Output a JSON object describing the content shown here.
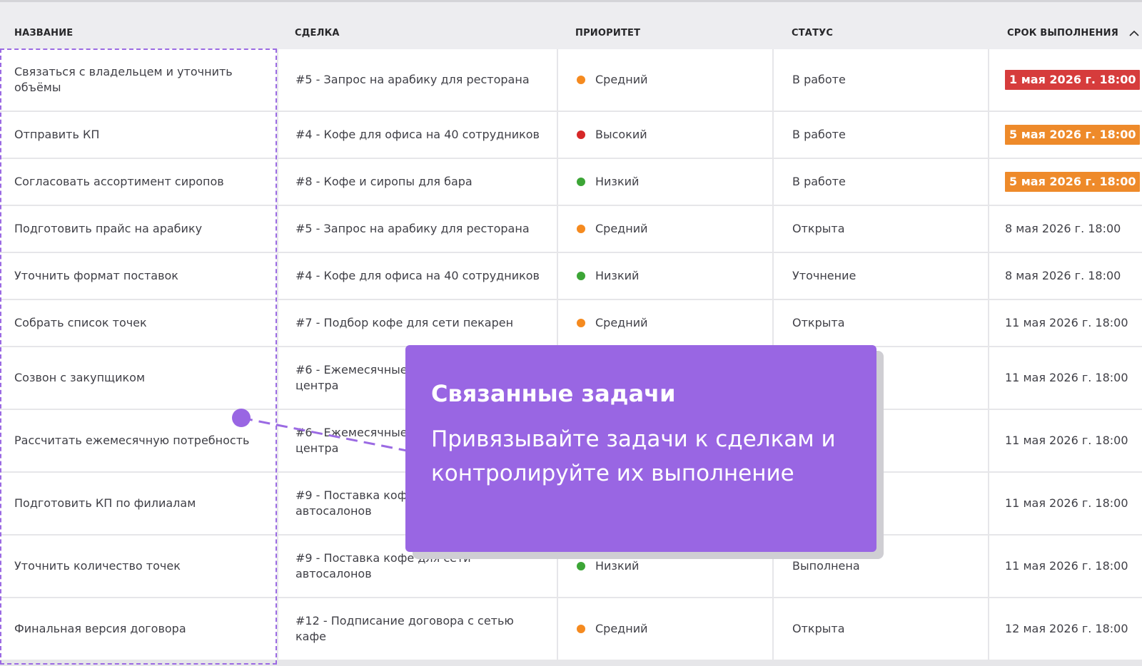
{
  "columns": {
    "name": "НАЗВАНИЕ",
    "deal": "СДЕЛКА",
    "priority": "ПРИОРИТЕТ",
    "status": "СТАТУС",
    "due": "СРОК ВЫПОЛНЕНИЯ"
  },
  "sort": {
    "column": "due",
    "direction": "ascending",
    "icon": "chevron-up-icon"
  },
  "colors": {
    "overdue": "#d63c3c",
    "soon": "#ee8a2a",
    "medium": "#f58a1f",
    "high": "#d62828",
    "low": "#3ca536",
    "accent": "#9966e3"
  },
  "rows": [
    {
      "name": "Связаться с владельцем и уточнить объёмы",
      "deal": "#5 - Запрос на арабику для ресторана",
      "priority": "Средний",
      "priority_color": "#f58a1f",
      "status": "В работе",
      "due": "1 мая 2026 г. 18:00",
      "due_style": "overdue"
    },
    {
      "name": "Отправить КП",
      "deal": "#4 - Кофе для офиса на 40 сотрудников",
      "priority": "Высокий",
      "priority_color": "#d62828",
      "status": "В работе",
      "due": "5 мая 2026 г. 18:00",
      "due_style": "soon"
    },
    {
      "name": "Согласовать ассортимент сиропов",
      "deal": "#8 - Кофе и сиропы для бара",
      "priority": "Низкий",
      "priority_color": "#3ca536",
      "status": "В работе",
      "due": "5 мая 2026 г. 18:00",
      "due_style": "soon"
    },
    {
      "name": "Подготовить прайс на арабику",
      "deal": "#5 - Запрос на арабику для ресторана",
      "priority": "Средний",
      "priority_color": "#f58a1f",
      "status": "Открыта",
      "due": "8 мая 2026 г. 18:00",
      "due_style": "plain"
    },
    {
      "name": "Уточнить формат поставок",
      "deal": "#4 - Кофе для офиса на 40 сотрудников",
      "priority": "Низкий",
      "priority_color": "#3ca536",
      "status": "Уточнение",
      "due": "8 мая 2026 г. 18:00",
      "due_style": "plain"
    },
    {
      "name": "Собрать список точек",
      "deal": "#7 - Подбор кофе для сети пекарен",
      "priority": "Средний",
      "priority_color": "#f58a1f",
      "status": "Открыта",
      "due": "11 мая 2026 г. 18:00",
      "due_style": "plain"
    },
    {
      "name": "Созвон с закупщиком",
      "deal": "#6 - Ежемесячные\nцентра",
      "priority": "",
      "priority_color": "",
      "status": "",
      "due": "11 мая 2026 г. 18:00",
      "due_style": "plain"
    },
    {
      "name": "Рассчитать ежемесячную потребность",
      "deal": "#6 - Ежемесячные\nцентра",
      "priority": "",
      "priority_color": "",
      "status": "",
      "due": "11 мая 2026 г. 18:00",
      "due_style": "plain"
    },
    {
      "name": "Подготовить КП по филиалам",
      "deal": "#9 - Поставка кофе\nавтосалонов",
      "priority": "",
      "priority_color": "",
      "status": "",
      "due": "11 мая 2026 г. 18:00",
      "due_style": "plain"
    },
    {
      "name": "Уточнить количество точек",
      "deal": "#9 - Поставка кофе для сети автосалонов",
      "priority": "Низкий",
      "priority_color": "#3ca536",
      "status": "Выполнена",
      "due": "11 мая 2026 г. 18:00",
      "due_style": "plain"
    },
    {
      "name": "Финальная версия договора",
      "deal": "#12 - Подписание договора с сетью кафе",
      "priority": "Средний",
      "priority_color": "#f58a1f",
      "status": "Открыта",
      "due": "12 мая 2026 г. 18:00",
      "due_style": "plain"
    }
  ],
  "tooltip": {
    "title": "Связанные задачи",
    "body": "Привязывайте задачи к сделкам и контролируйте их выполнение"
  }
}
